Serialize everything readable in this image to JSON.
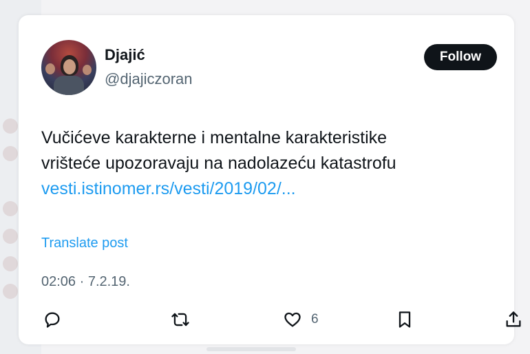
{
  "tweet": {
    "author": {
      "name": "Djajić",
      "handle": "@djajiczoran"
    },
    "follow_label": "Follow",
    "text_line1": "Vučićeve karakterne i mentalne karakteristike",
    "text_line2": "vrišteće upozoravaju na nadolazeću katastrofu",
    "link_text": "vesti.istinomer.rs/vesti/2019/02/...",
    "translate_label": "Translate post",
    "timestamp": "02:06 · 7.2.19.",
    "likes": "6"
  },
  "icons": {
    "reply": "reply-icon",
    "repost": "repost-icon",
    "like": "heart-icon",
    "bookmark": "bookmark-icon",
    "share": "share-icon"
  },
  "colors": {
    "accent": "#1d9bf0",
    "text": "#0f1419",
    "secondary": "#536471",
    "button_bg": "#0f1419"
  }
}
